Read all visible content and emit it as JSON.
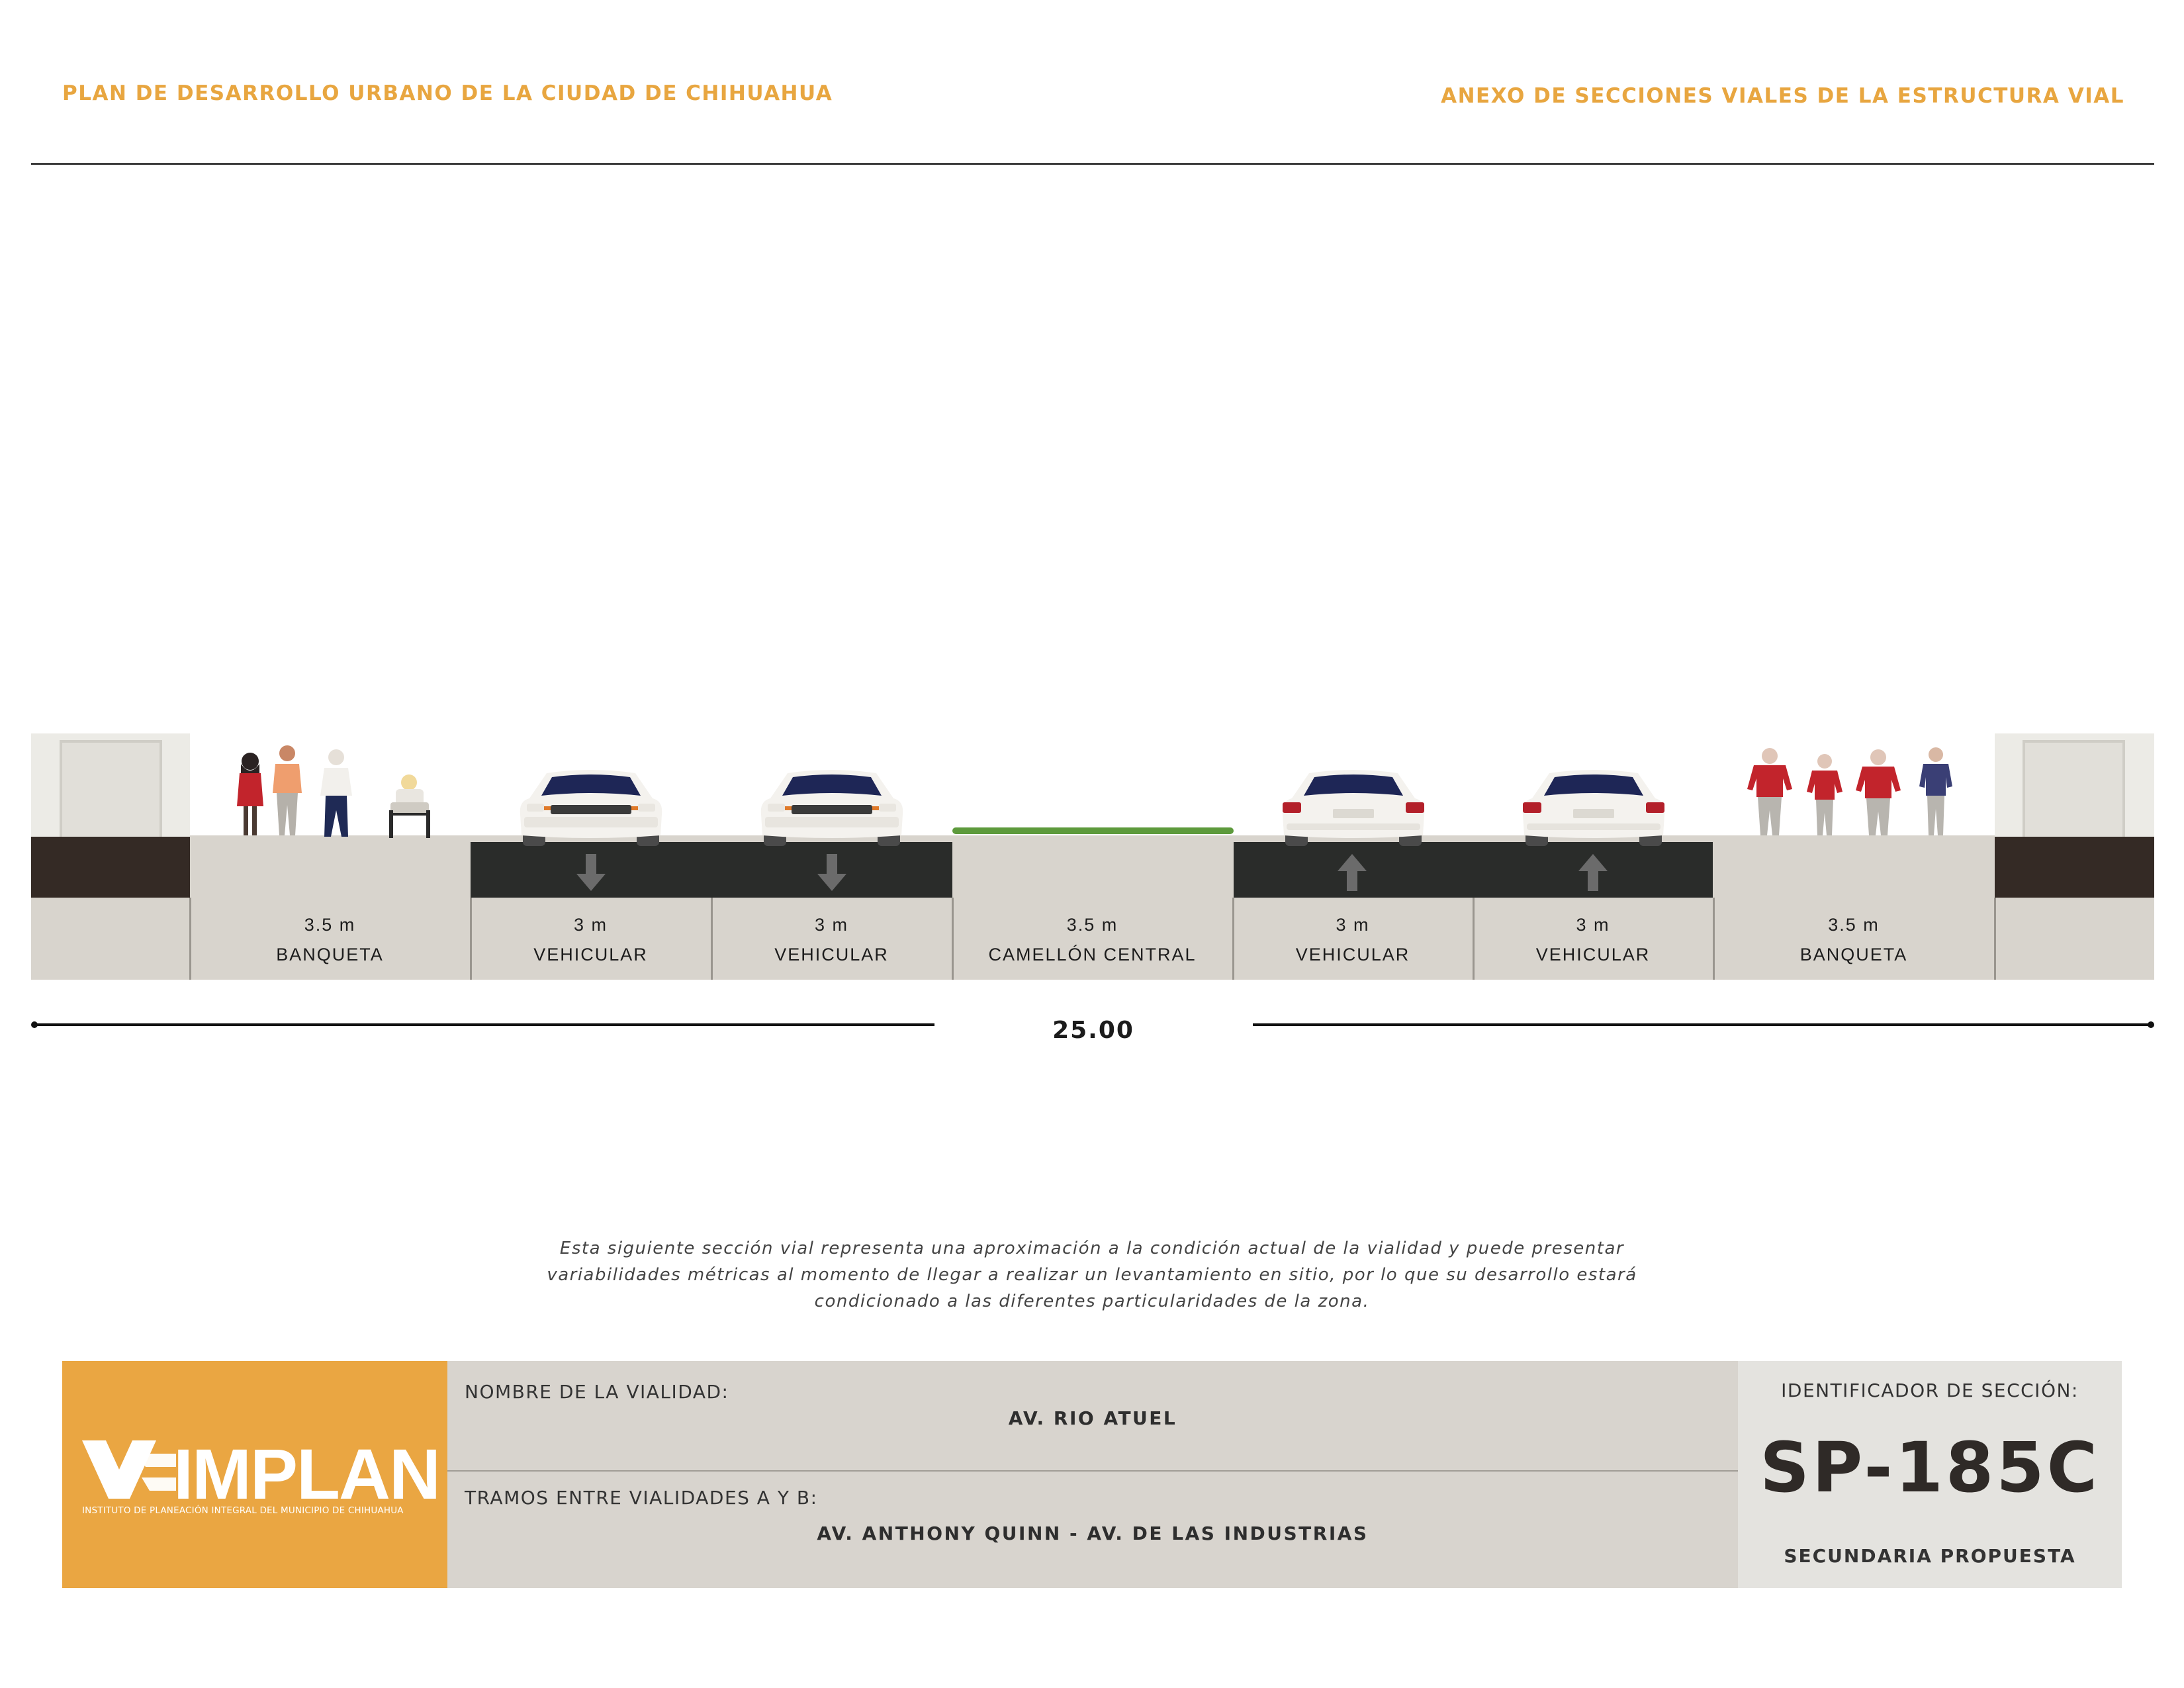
{
  "header": {
    "left_title": "PLAN DE DESARROLLO URBANO DE LA CIUDAD DE CHIHUAHUA",
    "right_title": "ANEXO DE SECCIONES VIALES DE LA ESTRUCTURA VIAL"
  },
  "section": {
    "segments": [
      {
        "width": "3.5 m",
        "name": "BANQUETA"
      },
      {
        "width": "3 m",
        "name": "VEHICULAR",
        "direction": "down"
      },
      {
        "width": "3 m",
        "name": "VEHICULAR",
        "direction": "down"
      },
      {
        "width": "3.5 m",
        "name": "CAMELLÓN CENTRAL"
      },
      {
        "width": "3 m",
        "name": "VEHICULAR",
        "direction": "up"
      },
      {
        "width": "3 m",
        "name": "VEHICULAR",
        "direction": "up"
      },
      {
        "width": "3.5 m",
        "name": "BANQUETA"
      }
    ],
    "total_width": "25.00"
  },
  "note": "Esta siguiente sección vial representa una aproximación a la condición actual de la vialidad y puede presentar variabilidades métricas al momento de llegar a realizar un levantamiento en sitio, por lo que su desarrollo estará condicionado a las diferentes particularidades de la zona.",
  "title_block": {
    "logo_text": "IMPLAN",
    "logo_subtitle": "INSTITUTO DE PLANEACIÓN INTEGRAL DEL MUNICIPIO DE CHIHUAHUA",
    "road_name_label": "NOMBRE DE LA VIALIDAD:",
    "road_name": "AV. RIO ATUEL",
    "segments_label": "TRAMOS ENTRE VIALIDADES A Y B:",
    "segments_value": "AV. ANTHONY QUINN - AV. DE LAS INDUSTRIAS",
    "id_label": "IDENTIFICADOR DE SECCIÓN:",
    "id_value": "SP-185C",
    "classification": "SECUNDARIA PROPUESTA"
  },
  "colors": {
    "accent": "#eaa642",
    "asphalt": "#2a2c2a",
    "ground": "#d8d4cd",
    "grass": "#5d9a3c"
  }
}
